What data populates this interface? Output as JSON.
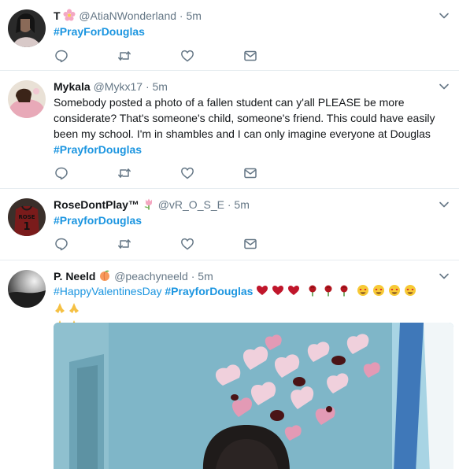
{
  "tweets": [
    {
      "name": "T",
      "handle": "@AtiaNWonderland",
      "sep": "·",
      "time": "5m",
      "hashtag": "#PrayForDouglas"
    },
    {
      "name": "Mykala",
      "handle": "@Mykx17",
      "sep": "·",
      "time": "5m",
      "text": "Somebody posted a photo of a fallen student can y'all PLEASE be more considerate? That's someone's child, someone's friend. This could have easily been my school. I'm in shambles and I can only imagine everyone at Douglas",
      "hashtag": "#PrayforDouglas"
    },
    {
      "name": "RoseDontPlay™",
      "handle": "@vR_O_S_E",
      "sep": "·",
      "time": "5m",
      "hashtag": "#PrayforDouglas",
      "jersey_text": "ROSE",
      "jersey_number": "1"
    },
    {
      "name": "P. Neeld",
      "handle": "@peachyneeld",
      "sep": "·",
      "time": "5m",
      "hashtag1": "#HappyValentinesDay",
      "hashtag2": "#PrayforDouglas"
    }
  ],
  "icons": {
    "reply": "reply-icon",
    "retweet": "retweet-icon",
    "like": "heart-icon",
    "dm": "envelope-icon",
    "more": "chevron-down-icon"
  },
  "colors": {
    "link": "#1b95e0",
    "muted": "#657786",
    "icon": "#657786",
    "divider": "#e6ecf0"
  }
}
